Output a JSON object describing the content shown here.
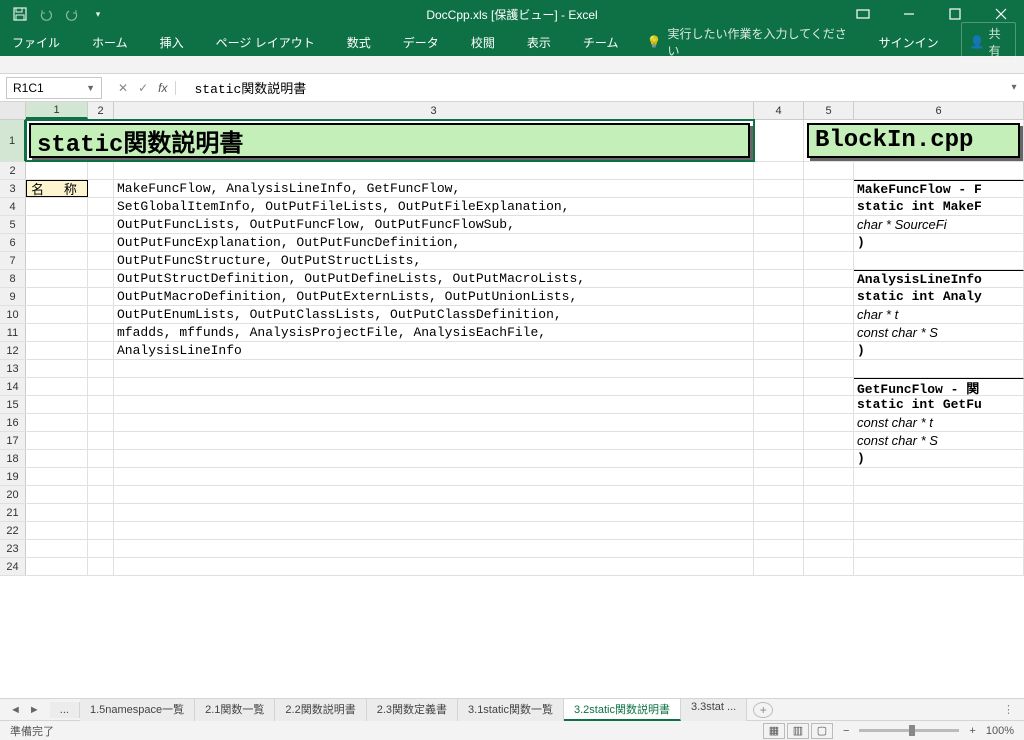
{
  "titlebar": {
    "title": "DocCpp.xls  [保護ビュー] - Excel"
  },
  "ribbon": {
    "tabs": [
      "ファイル",
      "ホーム",
      "挿入",
      "ページ レイアウト",
      "数式",
      "データ",
      "校閲",
      "表示",
      "チーム"
    ],
    "tellme": "実行したい作業を入力してください",
    "signin": "サインイン",
    "share": "共有"
  },
  "namebox": "R1C1",
  "formula": "static関数説明書",
  "columns": [
    "1",
    "2",
    "3",
    "4",
    "5",
    "6"
  ],
  "row1": {
    "title_left": "static関数説明書",
    "title_right": "BlockIn.cpp"
  },
  "rows": [
    {
      "n": "2",
      "c1": "",
      "c3": "",
      "c6": ""
    },
    {
      "n": "3",
      "c1": "名 称",
      "c3": "MakeFuncFlow, AnalysisLineInfo, GetFuncFlow,",
      "c6": "MakeFuncFlow - F"
    },
    {
      "n": "4",
      "c1": "",
      "c3": "SetGlobalItemInfo, OutPutFileLists, OutPutFileExplanation,",
      "c6": "static int MakeF"
    },
    {
      "n": "5",
      "c1": "",
      "c3": "OutPutFuncLists, OutPutFuncFlow, OutPutFuncFlowSub,",
      "c6": "  char * SourceFi"
    },
    {
      "n": "6",
      "c1": "",
      "c3": "OutPutFuncExplanation, OutPutFuncDefinition,",
      "c6": ")"
    },
    {
      "n": "7",
      "c1": "",
      "c3": "OutPutFuncStructure, OutPutStructLists,",
      "c6": ""
    },
    {
      "n": "8",
      "c1": "",
      "c3": "OutPutStructDefinition, OutPutDefineLists, OutPutMacroLists,",
      "c6": "AnalysisLineInfo"
    },
    {
      "n": "9",
      "c1": "",
      "c3": "OutPutMacroDefinition, OutPutExternLists, OutPutUnionLists,",
      "c6": "static int Analy"
    },
    {
      "n": "10",
      "c1": "",
      "c3": "OutPutEnumLists, OutPutClassLists, OutPutClassDefinition,",
      "c6": "  char *        t"
    },
    {
      "n": "11",
      "c1": "",
      "c3": "mfadds, mffunds, AnalysisProjectFile, AnalysisEachFile,",
      "c6": "  const char * S"
    },
    {
      "n": "12",
      "c1": "",
      "c3": "AnalysisLineInfo",
      "c6": ")"
    },
    {
      "n": "13",
      "c1": "",
      "c3": "",
      "c6": ""
    },
    {
      "n": "14",
      "c1": "",
      "c3": "",
      "c6": "GetFuncFlow - 関"
    },
    {
      "n": "15",
      "c1": "",
      "c3": "",
      "c6": "static int GetFu"
    },
    {
      "n": "16",
      "c1": "",
      "c3": "",
      "c6": "  const char * t"
    },
    {
      "n": "17",
      "c1": "",
      "c3": "",
      "c6": "  const char * S"
    },
    {
      "n": "18",
      "c1": "",
      "c3": "",
      "c6": ")"
    },
    {
      "n": "19",
      "c1": "",
      "c3": "",
      "c6": ""
    },
    {
      "n": "20",
      "c1": "",
      "c3": "",
      "c6": ""
    },
    {
      "n": "21",
      "c1": "",
      "c3": "",
      "c6": ""
    },
    {
      "n": "22",
      "c1": "",
      "c3": "",
      "c6": ""
    },
    {
      "n": "23",
      "c1": "",
      "c3": "",
      "c6": ""
    },
    {
      "n": "24",
      "c1": "",
      "c3": "",
      "c6": ""
    }
  ],
  "sheets": {
    "ellipsis": "...",
    "tabs": [
      "1.5namespace一覧",
      "2.1関数一覧",
      "2.2関数説明書",
      "2.3関数定義書",
      "3.1static関数一覧",
      "3.2static関数説明書",
      "3.3stat ..."
    ],
    "active_index": 5
  },
  "statusbar": {
    "ready": "準備完了",
    "zoom": "100%"
  }
}
